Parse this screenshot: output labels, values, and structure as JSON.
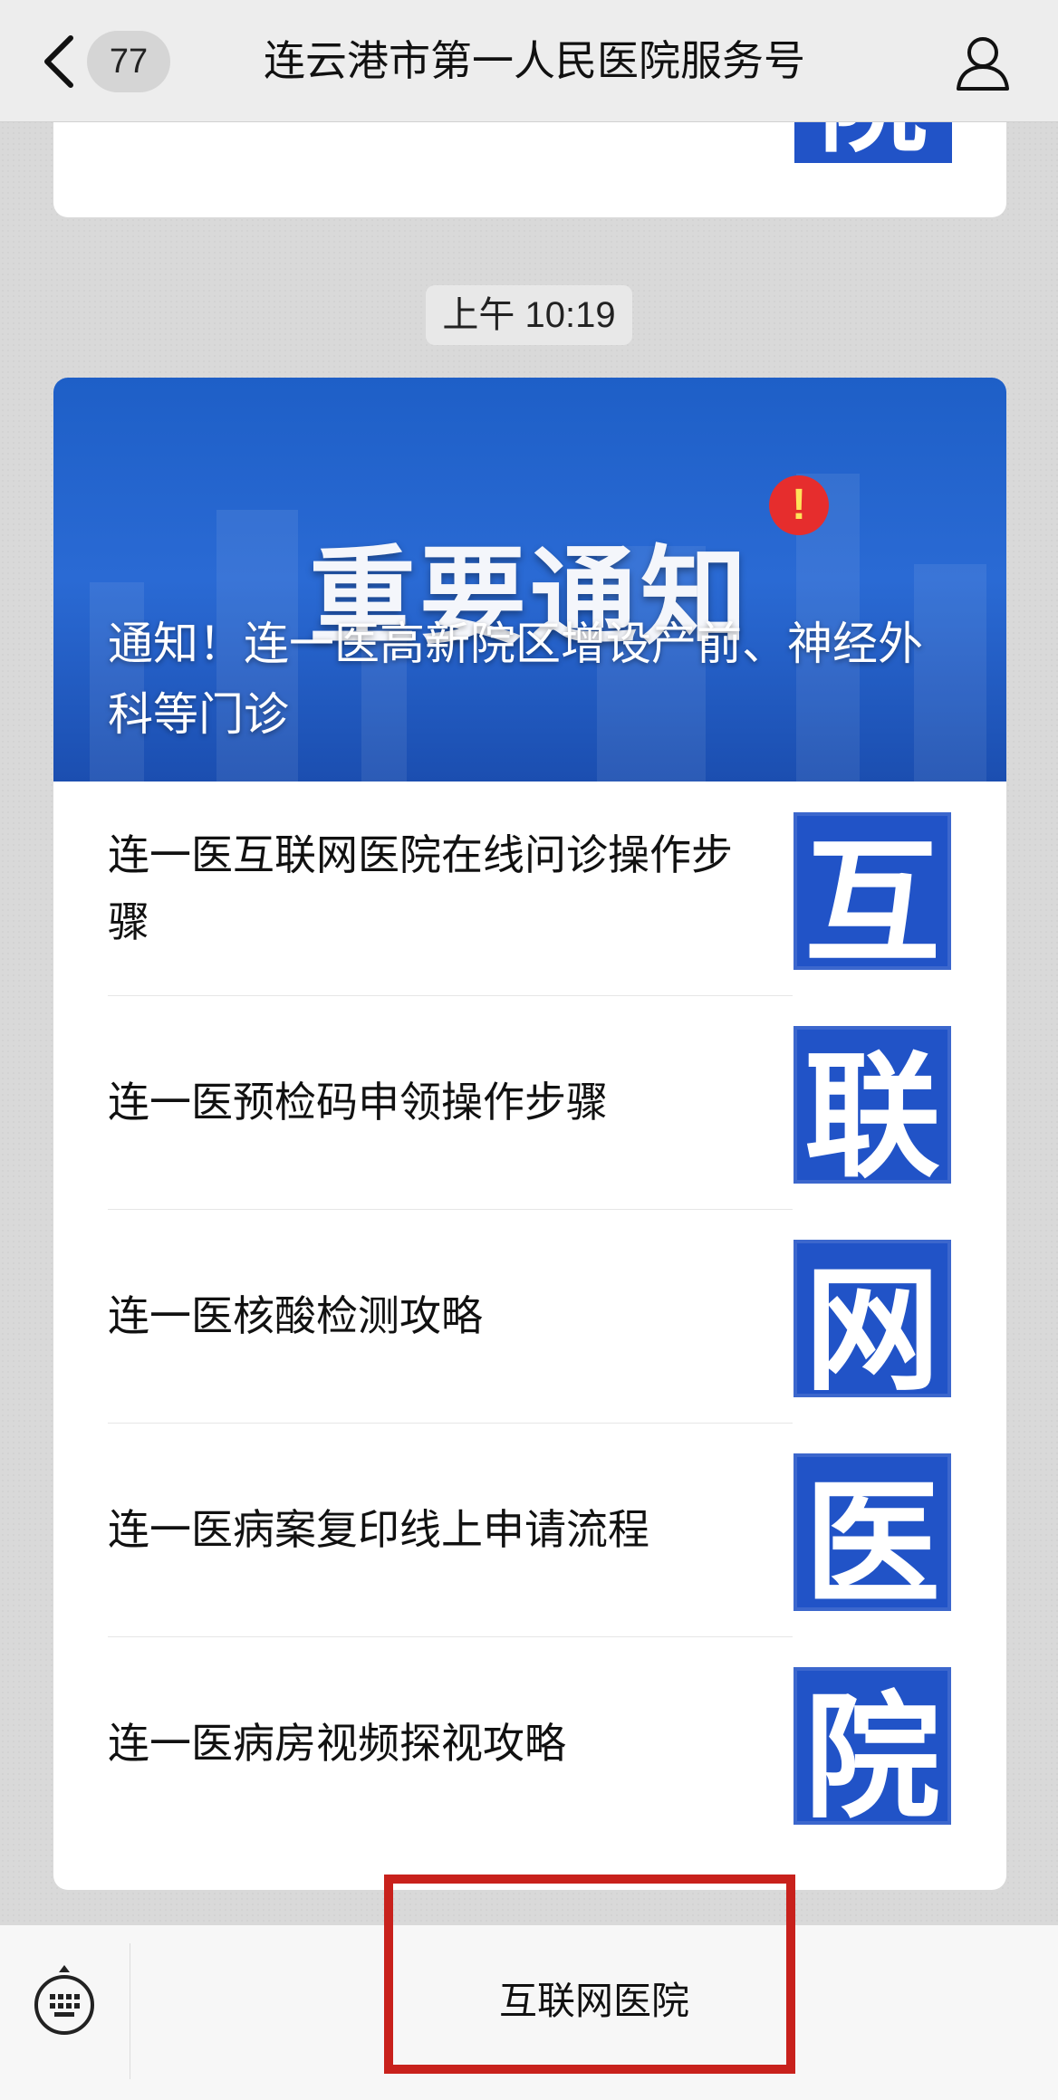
{
  "header": {
    "badge_count": "77",
    "title": "连云港市第一人民医院服务号"
  },
  "previous_card": {
    "thumb_glyph": "院"
  },
  "timestamp": "上午 10:19",
  "article": {
    "cover_title": "重要通知",
    "cover_alert": "!",
    "headline": "通知！连一医高新院区增设产前、神经外科等门诊",
    "items": [
      {
        "title": "连一医互联网医院在线问诊操作步骤",
        "thumb": "互"
      },
      {
        "title": "连一医预检码申领操作步骤",
        "thumb": "联"
      },
      {
        "title": "连一医核酸检测攻略",
        "thumb": "网"
      },
      {
        "title": "连一医病案复印线上申请流程",
        "thumb": "医"
      },
      {
        "title": "连一医病房视频探视攻略",
        "thumb": "院"
      }
    ]
  },
  "bottom_menu": {
    "button_label": "互联网医院"
  },
  "colors": {
    "thumb_blue": "#2153c7",
    "highlight_red": "#c8211c"
  }
}
